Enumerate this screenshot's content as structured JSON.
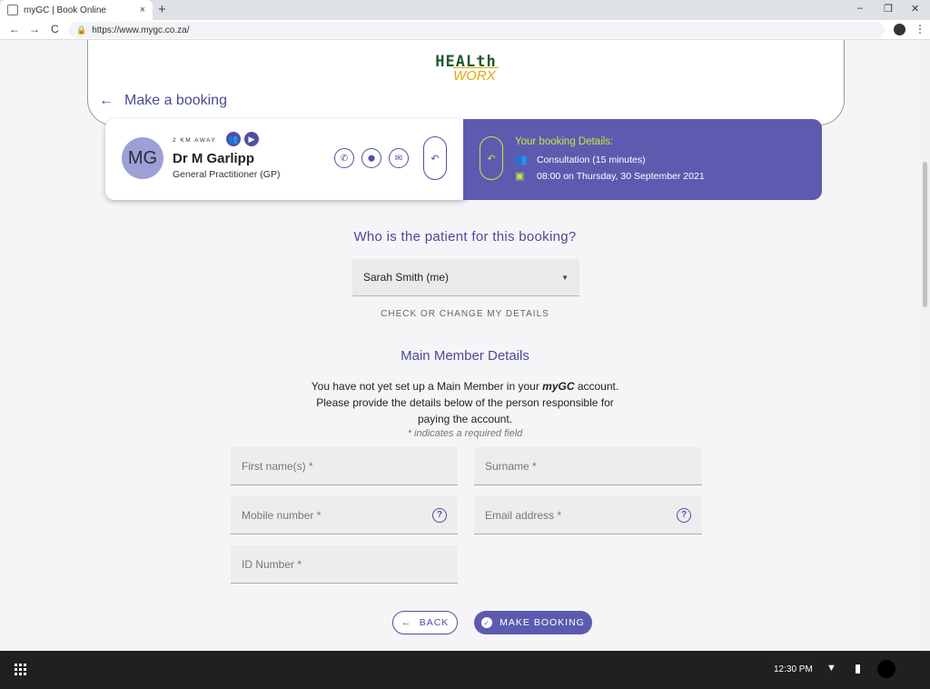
{
  "browser": {
    "tab_title": "myGC | Book Online",
    "tab_close": "×",
    "new_tab": "+",
    "url": "https://www.mygc.co.za/",
    "back": "←",
    "forward": "→",
    "reload": "C",
    "minimize": "–",
    "restore": "❐",
    "close": "✕",
    "menu": "⋮"
  },
  "header": {
    "logo_line1": "HEALth",
    "logo_line2": "WORX",
    "back_arrow": "←",
    "title": "Make a booking"
  },
  "doctor": {
    "initials": "MG",
    "distance": "2 KM AWAY",
    "name": "Dr M Garlipp",
    "role": "General Practitioner (GP)",
    "badge_people": "👥",
    "badge_video": "▶",
    "phone_icon": "✆",
    "location_icon": "⬤",
    "email_icon": "✉",
    "undo_icon": "↶"
  },
  "booking_details": {
    "title": "Your booking Details:",
    "consultation": "Consultation (15 minutes)",
    "datetime": "08:00 on Thursday, 30 September 2021",
    "undo_icon": "↶",
    "people_icon": "👥",
    "calendar_icon": "▣"
  },
  "patient": {
    "question": "Who is the patient for this booking?",
    "selected": "Sarah Smith (me)",
    "caret": "▼",
    "check_link": "CHECK OR CHANGE MY DETAILS"
  },
  "main_member": {
    "title": "Main Member Details",
    "line1_pre": "You have not yet set up a Main Member in your ",
    "line1_brand": "myGC",
    "line1_post": " account.",
    "line2": "Please provide the details below of the person responsible for",
    "line3": "paying the account.",
    "required_note": "* indicates a required field"
  },
  "fields": {
    "first_name": "First name(s) *",
    "surname": "Surname *",
    "mobile": "Mobile number *",
    "email": "Email address *",
    "id_number": "ID Number *",
    "help": "?"
  },
  "actions": {
    "back_arrow": "←",
    "back": "BACK",
    "make_check": "✓",
    "make": "MAKE BOOKING"
  },
  "taskbar": {
    "time": "12:30 PM",
    "wifi": "▼"
  },
  "colors": {
    "accent": "#5d5bb0",
    "highlight": "#c8e640",
    "logo_green": "#1f5c2b",
    "logo_yellow": "#e0a800"
  }
}
